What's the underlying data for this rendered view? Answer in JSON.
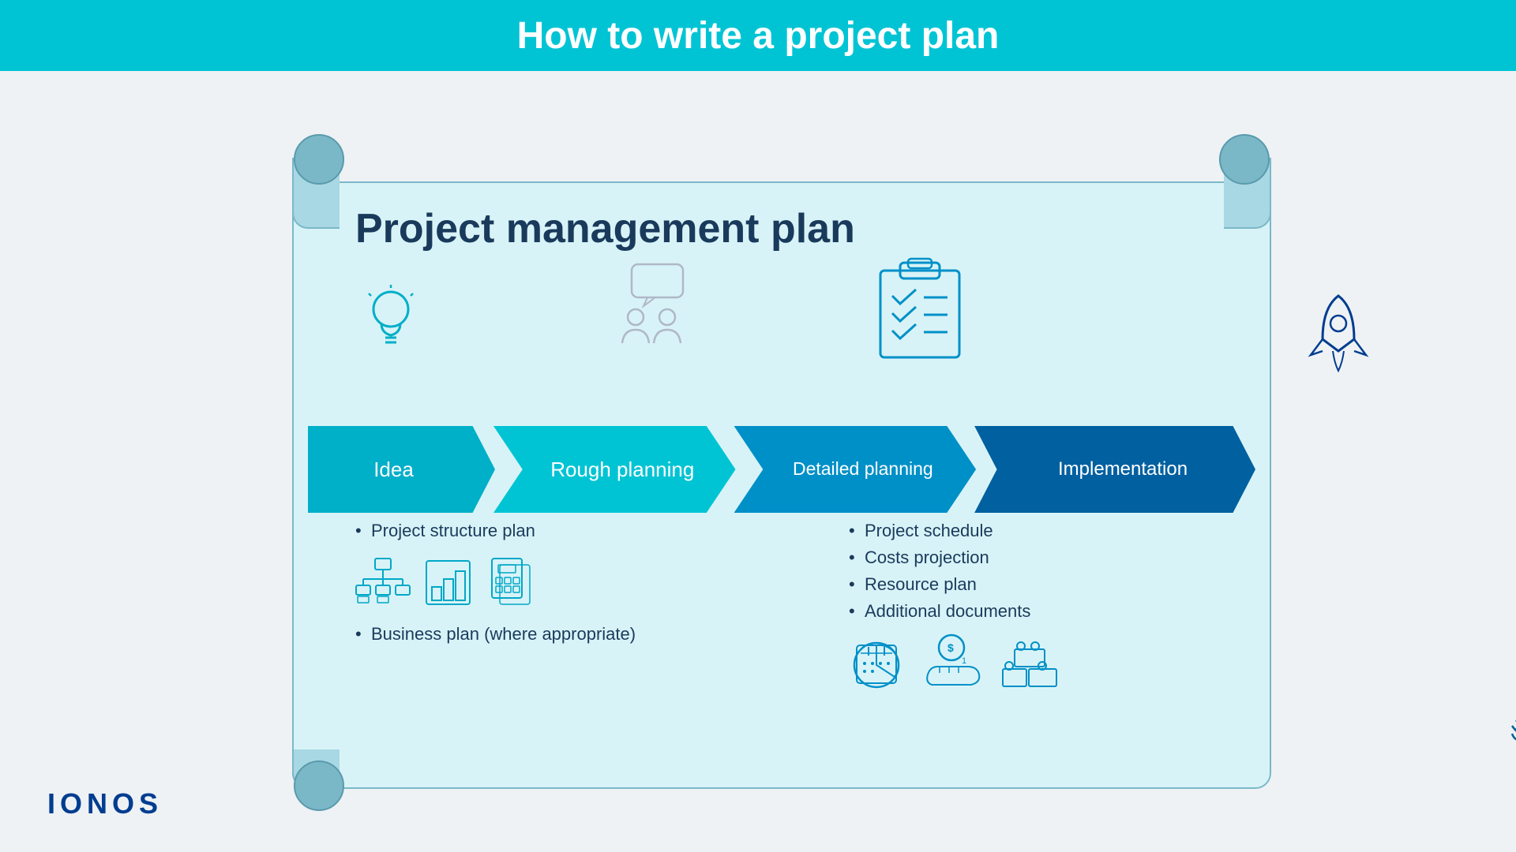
{
  "header": {
    "title": "How to write a project plan",
    "bg_color": "#00c4d4"
  },
  "logo": {
    "text": "IONOS",
    "color": "#003d8f"
  },
  "plan": {
    "title": "Project management plan"
  },
  "arrows": [
    {
      "label": "Idea",
      "color": "#00afc8"
    },
    {
      "label": "Rough planning",
      "color": "#00c4d4"
    },
    {
      "label": "Detailed planning",
      "color": "#0090c8"
    },
    {
      "label": "Implementation",
      "color": "#0060a0"
    }
  ],
  "rough_planning": {
    "items": [
      "Project structure plan",
      "Business plan (where appropriate)"
    ]
  },
  "detailed_planning": {
    "items": [
      "Project schedule",
      "Costs projection",
      "Resource plan",
      "Additional documents"
    ]
  }
}
